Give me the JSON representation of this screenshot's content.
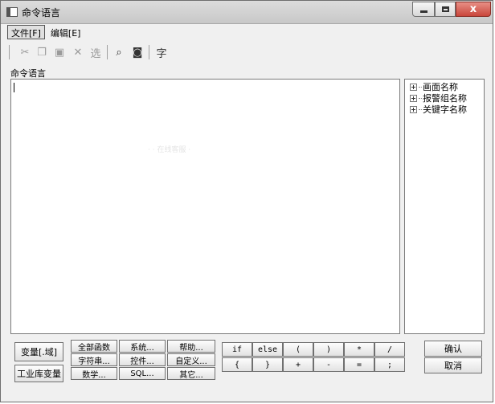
{
  "window": {
    "title": "命令语言",
    "close_glyph": "x"
  },
  "menu": [
    "文件[F]",
    "编辑[E]"
  ],
  "toolbar": {
    "select_label": "选",
    "font_label": "字"
  },
  "editor": {
    "label": "命令语言",
    "watermark": "·  ·  在线客服  ·"
  },
  "tree": [
    "画面名称",
    "报警组名称",
    "关键字名称"
  ],
  "left_buttons": [
    "变量[.域]",
    "工业库变量"
  ],
  "func_buttons": [
    [
      "全部函数",
      "系统...",
      "帮助..."
    ],
    [
      "字符串...",
      "控件...",
      "自定义..."
    ],
    [
      "数学...",
      "SQL...",
      "其它..."
    ]
  ],
  "op_buttons": [
    [
      "if",
      "else",
      "(",
      ")",
      "*",
      "/"
    ],
    [
      "{",
      "}",
      "+",
      "-",
      "=",
      ";"
    ]
  ],
  "confirm_label": "确认",
  "cancel_label": "取消"
}
